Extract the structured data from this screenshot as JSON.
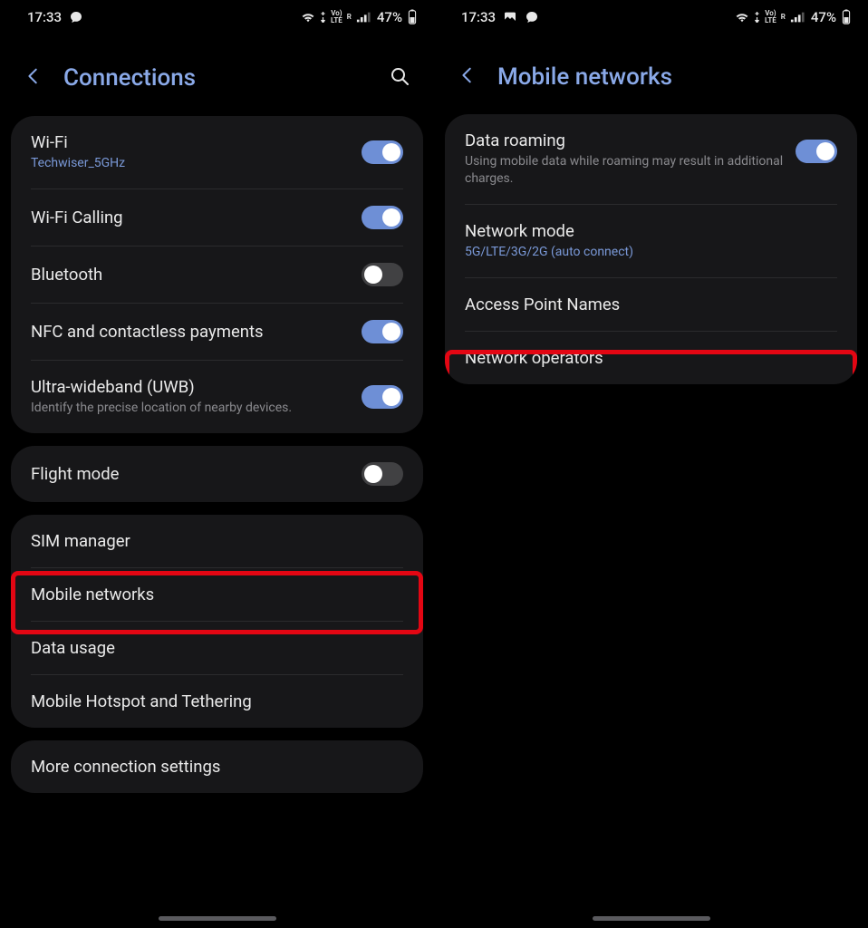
{
  "left": {
    "status": {
      "time": "17:33",
      "battery": "47%"
    },
    "title": "Connections",
    "group1": {
      "wifi": {
        "label": "Wi-Fi",
        "sub": "Techwiser_5GHz",
        "on": true
      },
      "wifi_calling": {
        "label": "Wi-Fi Calling",
        "on": true
      },
      "bluetooth": {
        "label": "Bluetooth",
        "on": false
      },
      "nfc": {
        "label": "NFC and contactless payments",
        "on": true
      },
      "uwb": {
        "label": "Ultra-wideband (UWB)",
        "sub": "Identify the precise location of nearby devices.",
        "on": true
      }
    },
    "group2": {
      "flight": {
        "label": "Flight mode",
        "on": false
      }
    },
    "group3": {
      "sim": "SIM manager",
      "mobile_net": "Mobile networks",
      "data_usage": "Data usage",
      "hotspot": "Mobile Hotspot and Tethering"
    },
    "group4": {
      "more": "More connection settings"
    }
  },
  "right": {
    "status": {
      "time": "17:33",
      "battery": "47%"
    },
    "title": "Mobile networks",
    "rows": {
      "roaming": {
        "label": "Data roaming",
        "sub": "Using mobile data while roaming may result in additional charges.",
        "on": true
      },
      "mode": {
        "label": "Network mode",
        "sub": "5G/LTE/3G/2G (auto connect)"
      },
      "apn": {
        "label": "Access Point Names"
      },
      "operators": {
        "label": "Network operators"
      }
    }
  }
}
